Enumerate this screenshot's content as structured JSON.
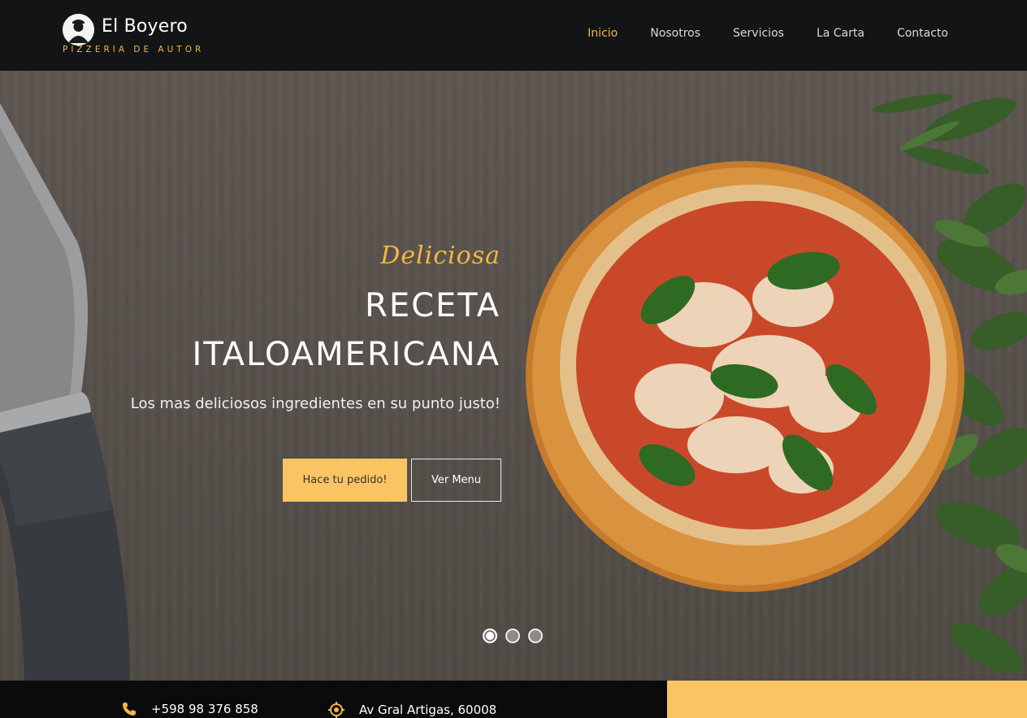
{
  "brand": {
    "name": "El Boyero",
    "tagline": "PIZZERIA DE AUTOR"
  },
  "nav": {
    "items": [
      {
        "label": "Inicio",
        "active": true
      },
      {
        "label": "Nosotros",
        "active": false
      },
      {
        "label": "Servicios",
        "active": false
      },
      {
        "label": "La Carta",
        "active": false
      },
      {
        "label": "Contacto",
        "active": false
      }
    ]
  },
  "hero": {
    "script": "Deliciosa",
    "title_line1": "RECETA",
    "title_line2": "ITALOAMERICANA",
    "subtitle": "Los mas deliciosos ingredientes en su punto justo!",
    "primary_button": "Hace tu pedido!",
    "secondary_button": "Ver Menu",
    "slides_total": 3,
    "active_slide": 1
  },
  "contact": {
    "phone": "+598 98 376 858",
    "phone_icon": "phone-icon",
    "address": "Av Gral Artigas, 60008",
    "address_icon": "location-icon"
  },
  "colors": {
    "accent": "#f5b642",
    "button": "#fbc462",
    "header_bg": "#121416"
  }
}
